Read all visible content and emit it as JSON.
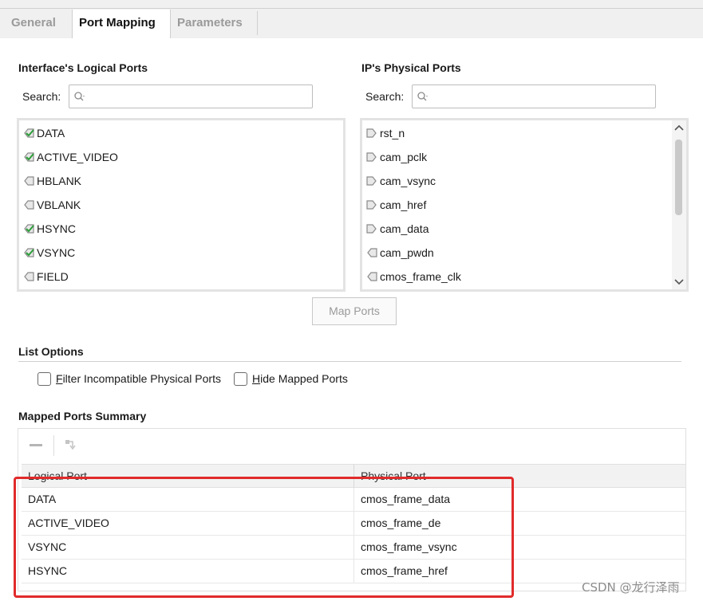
{
  "tabs": [
    {
      "label": "General",
      "active": false
    },
    {
      "label": "Port Mapping",
      "active": true
    },
    {
      "label": "Parameters",
      "active": false
    }
  ],
  "logical": {
    "title": "Interface's Logical Ports",
    "search_label": "Search:",
    "items": [
      {
        "label": "DATA",
        "mapped": true
      },
      {
        "label": "ACTIVE_VIDEO",
        "mapped": true
      },
      {
        "label": "HBLANK",
        "mapped": false
      },
      {
        "label": "VBLANK",
        "mapped": false
      },
      {
        "label": "HSYNC",
        "mapped": true
      },
      {
        "label": "VSYNC",
        "mapped": true
      },
      {
        "label": "FIELD",
        "mapped": false
      }
    ]
  },
  "physical": {
    "title": "IP's Physical Ports",
    "search_label": "Search:",
    "items": [
      {
        "label": "rst_n",
        "direction": "in"
      },
      {
        "label": "cam_pclk",
        "direction": "in"
      },
      {
        "label": "cam_vsync",
        "direction": "in"
      },
      {
        "label": "cam_href",
        "direction": "in"
      },
      {
        "label": "cam_data",
        "direction": "in"
      },
      {
        "label": "cam_pwdn",
        "direction": "out"
      },
      {
        "label": "cmos_frame_clk",
        "direction": "out"
      }
    ]
  },
  "map_ports_label": "Map Ports",
  "list_options": {
    "title": "List Options",
    "filter_label": "Filter Incompatible Physical Ports",
    "hide_label": "Hide Mapped Ports"
  },
  "summary": {
    "title": "Mapped Ports Summary",
    "columns": [
      "Logical Port",
      "Physical Port"
    ],
    "rows": [
      [
        "DATA",
        "cmos_frame_data"
      ],
      [
        "ACTIVE_VIDEO",
        "cmos_frame_de"
      ],
      [
        "VSYNC",
        "cmos_frame_vsync"
      ],
      [
        "HSYNC",
        "cmos_frame_href"
      ]
    ]
  },
  "watermark": "CSDN @龙行泽雨",
  "colors": {
    "highlight": "#e12b2b",
    "check_green": "#2e9e3a"
  }
}
